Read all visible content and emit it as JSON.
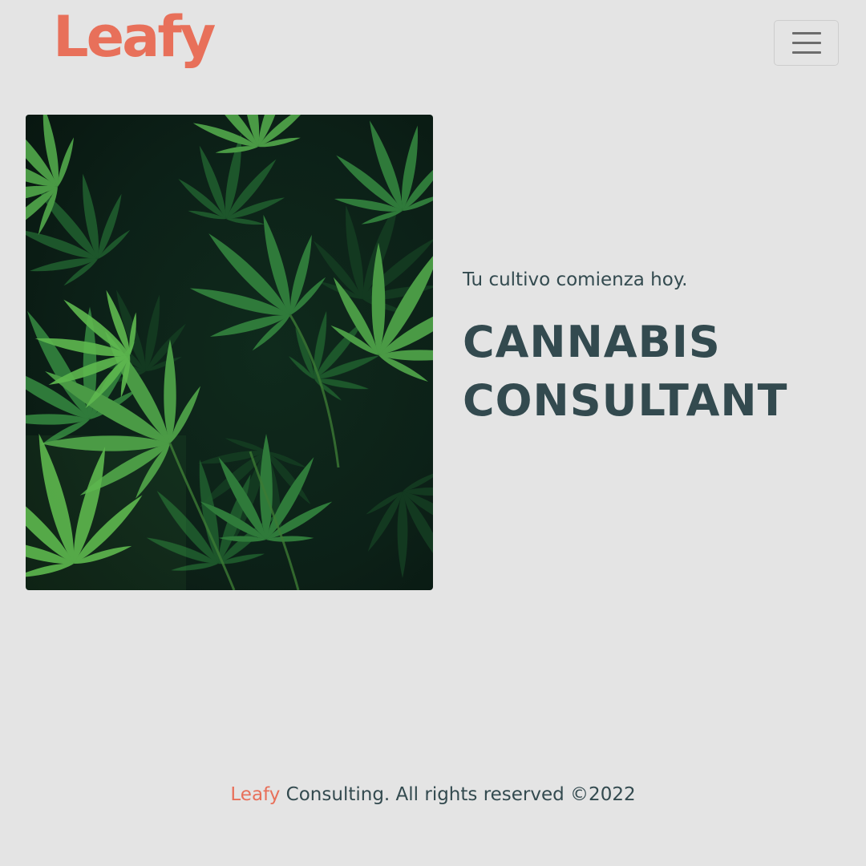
{
  "colors": {
    "background": "#e4e4e4",
    "brand": "#e8705a",
    "text": "#334a4f",
    "toggle_bar": "#6c6c6c"
  },
  "header": {
    "logo_text": "Leafy",
    "menu_icon": "hamburger-menu-icon"
  },
  "hero": {
    "image_subject": "cannabis-leaves-photo",
    "tagline": "Tu cultivo comienza hoy.",
    "headline_line1": "CANNABIS",
    "headline_line2": "CONSULTANT"
  },
  "footer": {
    "brand": "Leafy",
    "text": "Consulting. All rights reserved ©2022"
  }
}
